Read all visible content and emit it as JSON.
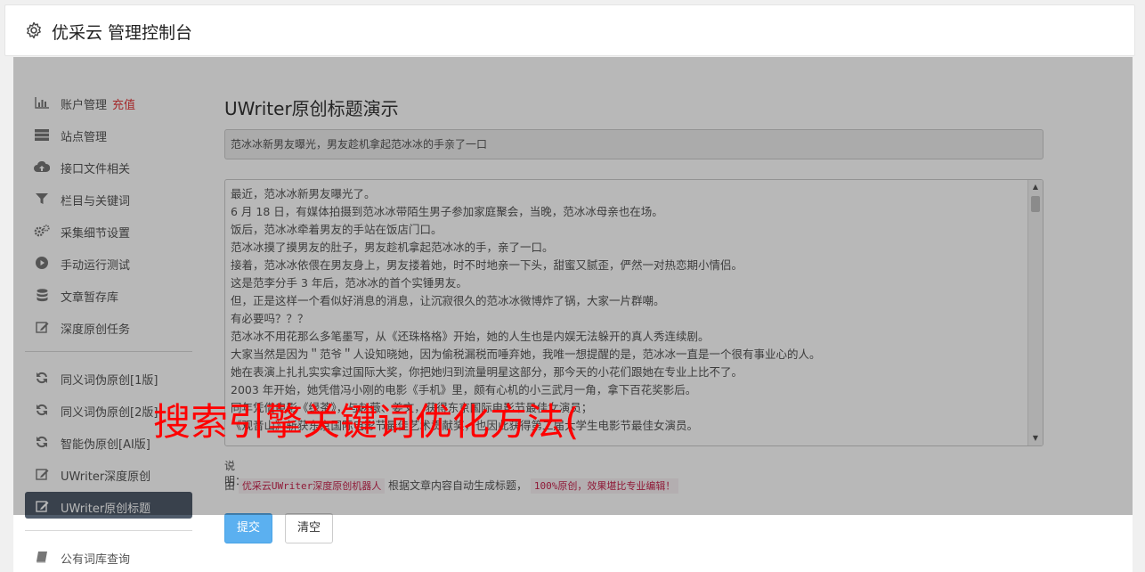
{
  "header": {
    "title": "优采云 管理控制台",
    "icon": "gear-icon"
  },
  "sidebar": {
    "items": [
      {
        "label": "账户管理",
        "tag": "充值",
        "icon": "bar-chart-icon"
      },
      {
        "label": "站点管理",
        "icon": "server-icon"
      },
      {
        "label": "接口文件相关",
        "icon": "cloud-upload-icon"
      },
      {
        "label": "栏目与关键词",
        "icon": "filter-icon"
      },
      {
        "label": "采集细节设置",
        "icon": "gears-icon"
      },
      {
        "label": "手动运行测试",
        "icon": "play-circle-icon"
      },
      {
        "label": "文章暂存库",
        "icon": "database-icon"
      },
      {
        "label": "深度原创任务",
        "icon": "edit-icon"
      },
      {
        "label": "同义词伪原创[1版]",
        "icon": "refresh-icon"
      },
      {
        "label": "同义词伪原创[2版]",
        "icon": "refresh-icon"
      },
      {
        "label": "智能伪原创[AI版]",
        "icon": "refresh-icon"
      },
      {
        "label": "UWriter深度原创",
        "icon": "edit-icon"
      },
      {
        "label": "UWriter原创标题",
        "icon": "edit-icon",
        "active": true
      },
      {
        "label": "公有词库查询",
        "icon": "book-icon"
      }
    ]
  },
  "main": {
    "heading": "UWriter原创标题演示",
    "title_value": "范冰冰新男友曝光，男友趁机拿起范冰冰的手亲了一口",
    "article_lines": [
      "最近，范冰冰新男友曝光了。",
      "6 月 18 日，有媒体拍摄到范冰冰带陌生男子参加家庭聚会，当晚，范冰冰母亲也在场。",
      "饭后，范冰冰牵着男友的手站在饭店门口。",
      "范冰冰摸了摸男友的肚子，男友趁机拿起范冰冰的手，亲了一口。",
      "接着，范冰冰依偎在男友身上，男友搂着她，时不时地亲一下头，甜蜜又腻歪，俨然一对热恋期小情侣。",
      "这是范李分手 3 年后，范冰冰的首个实锤男友。",
      "但，正是这样一个看似好消息的消息，让沉寂很久的范冰冰微博炸了锅，大家一片群嘲。",
      "有必要吗？？？",
      "范冰冰不用花那么多笔墨写，从《还珠格格》开始，她的人生也是内娱无法躲开的真人秀连续剧。",
      "大家当然是因为＂范爷＂人设知晓她，因为偷税漏税而唾弃她，我唯一想提醒的是，范冰冰一直是一个很有事业心的人。",
      "她在表演上扎扎实实拿过国际大奖，你把她归到流量明星这部分，那今天的小花们跟她在专业上比不了。",
      "2003 年开始，她凭借冯小刚的电影《手机》里，颇有心机的小三武月一角，拿下百花奖影后。",
      "同年凭借电影《绿茶》，与赵薇、姜文，获得东京国际电影节最佳女演员；",
      "《观音山》斩获东京国际电影节最佳艺术贡献奖，也因此获得第二届大学生电影节最佳女演员。"
    ],
    "note_label": "说明：",
    "note_prefix": "由",
    "note_code1": "优采云UWriter深度原创机器人",
    "note_middle": "根据文章内容自动生成标题，",
    "note_code2": "100%原创，效果堪比专业编辑！",
    "submit_label": "提交",
    "clear_label": "清空"
  },
  "watermark": "搜索引擎关键词优化方法(",
  "colors": {
    "accent": "#5bb0f0",
    "active_nav": "#4f5b6a",
    "highlight_red": "#e4393c",
    "watermark_red": "#ff0000"
  }
}
